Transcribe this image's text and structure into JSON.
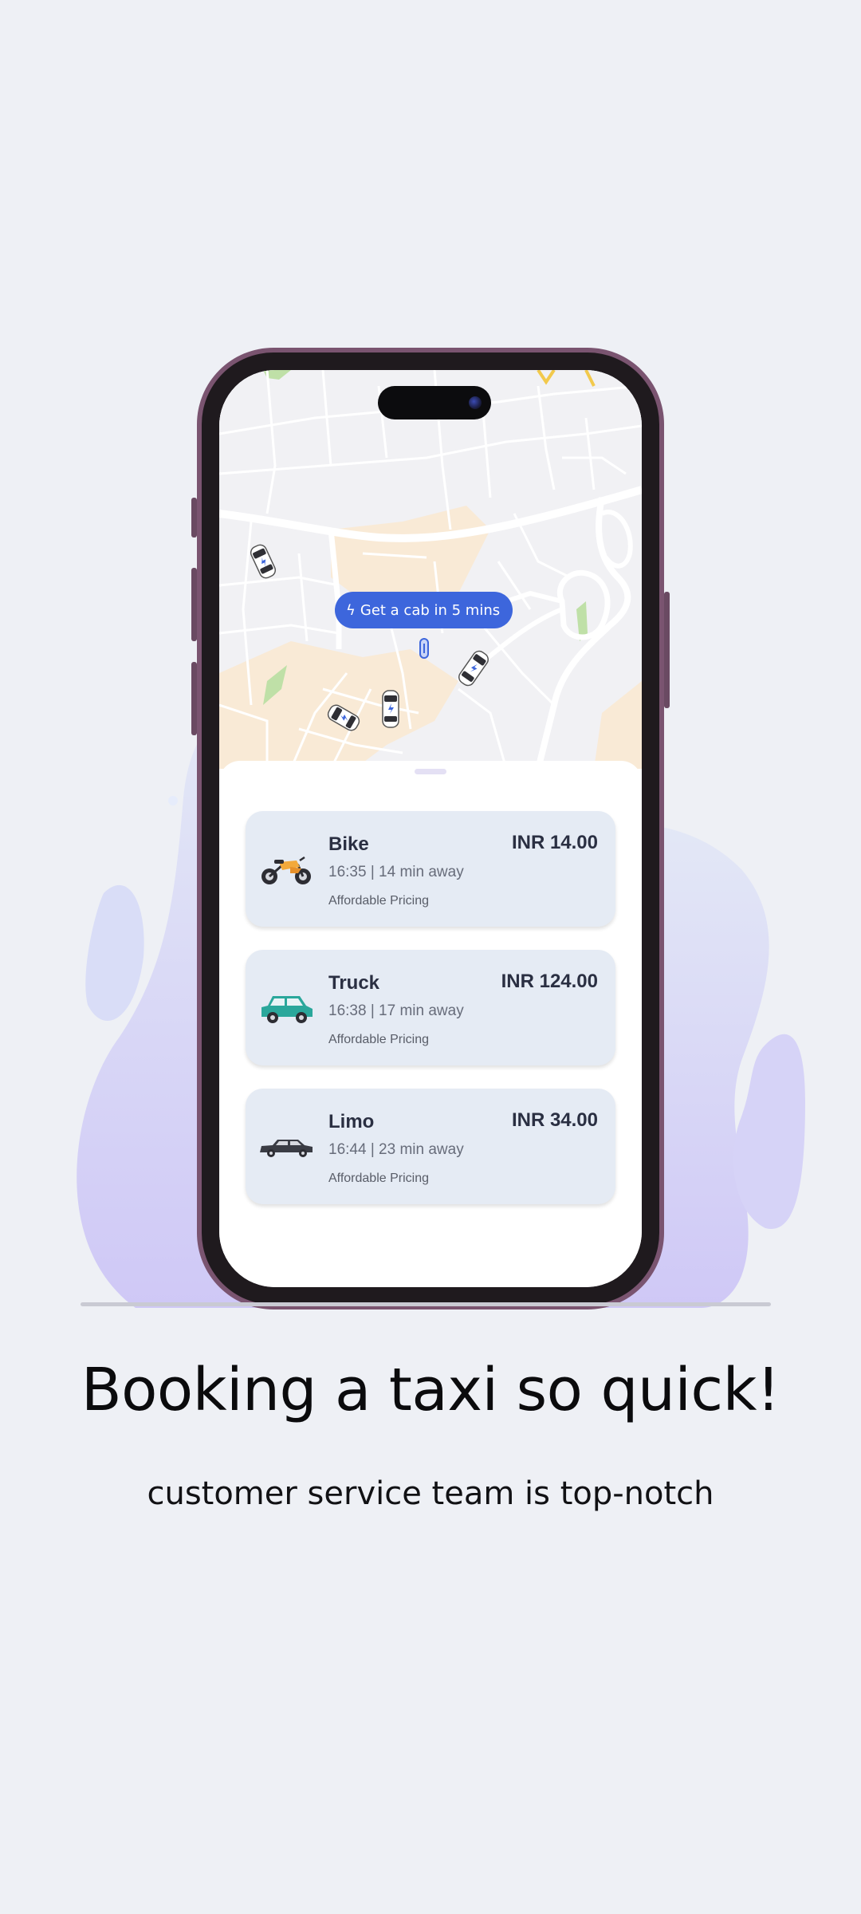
{
  "map": {
    "badge_label": "Get a cab in 5 mins",
    "badge_icon": "lightning-icon"
  },
  "rides": [
    {
      "name": "Bike",
      "price": "INR 14.00",
      "eta": "16:35 | 14 min away",
      "tag": "Affordable Pricing",
      "icon": "motorcycle-icon"
    },
    {
      "name": "Truck",
      "price": "INR 124.00",
      "eta": "16:38 | 17 min away",
      "tag": "Affordable Pricing",
      "icon": "car-icon"
    },
    {
      "name": "Limo",
      "price": "INR 34.00",
      "eta": "16:44 | 23 min away",
      "tag": "Affordable Pricing",
      "icon": "limousine-icon"
    }
  ],
  "onboarding": {
    "title": "Booking a taxi so quick!",
    "subtitle": "customer service team is top-notch"
  },
  "colors": {
    "accent": "#3d66dc",
    "background": "#eef0f5",
    "card": "#e5ebf4",
    "blob": "#d4cdf6"
  }
}
